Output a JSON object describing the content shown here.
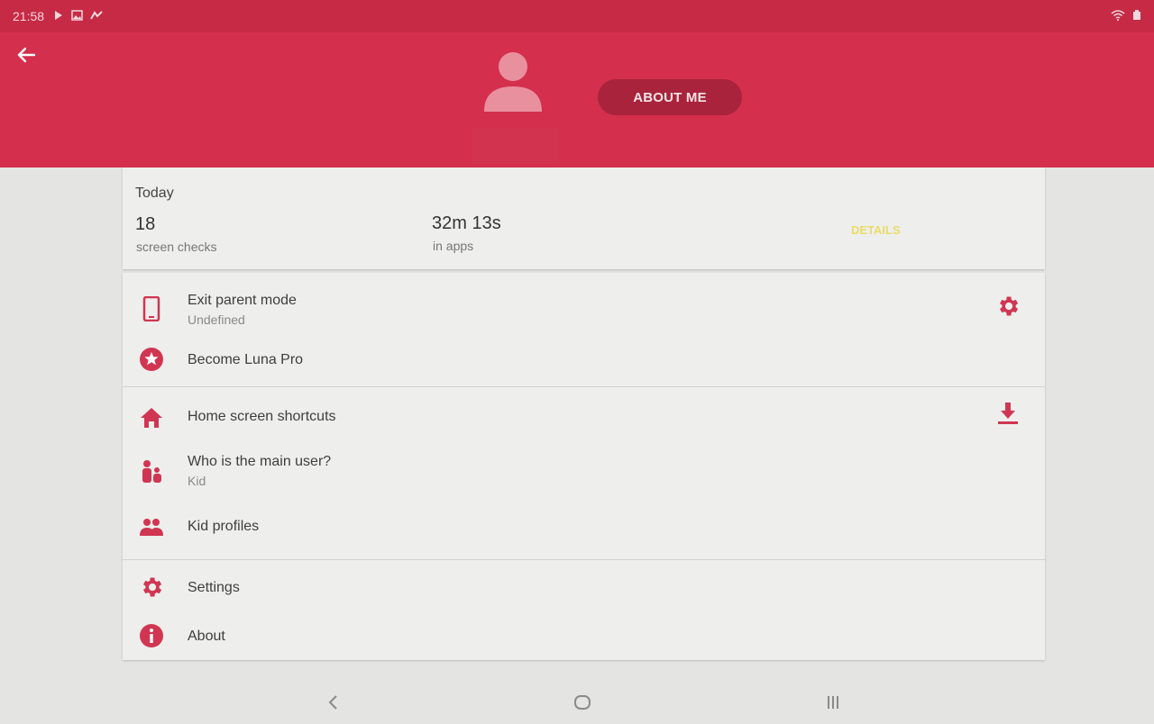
{
  "status_bar": {
    "time": "21:58"
  },
  "header": {
    "about_me_label": "ABOUT ME"
  },
  "today": {
    "title": "Today",
    "screen_checks_value": "18",
    "screen_checks_label": "screen checks",
    "in_apps_value": "32m 13s",
    "in_apps_label": "in apps",
    "details_label": "DETAILS"
  },
  "menu": {
    "exit_parent_mode": {
      "label": "Exit parent mode",
      "sub": "Undefined"
    },
    "become_pro": {
      "label": "Become Luna Pro"
    },
    "home_shortcuts": {
      "label": "Home screen shortcuts"
    },
    "main_user": {
      "label": "Who is the main user?",
      "sub": "Kid"
    },
    "kid_profiles": {
      "label": "Kid profiles"
    },
    "settings": {
      "label": "Settings"
    },
    "about": {
      "label": "About"
    }
  },
  "colors": {
    "accent": "#d42f4d",
    "icon": "#d03652",
    "background": "#e4e4e2",
    "card": "#eeeeec"
  },
  "icons": [
    "back-arrow-icon",
    "avatar-icon",
    "phone-icon",
    "star-icon",
    "gear-icon",
    "home-icon",
    "download-icon",
    "family-icon",
    "people-icon",
    "info-icon"
  ]
}
